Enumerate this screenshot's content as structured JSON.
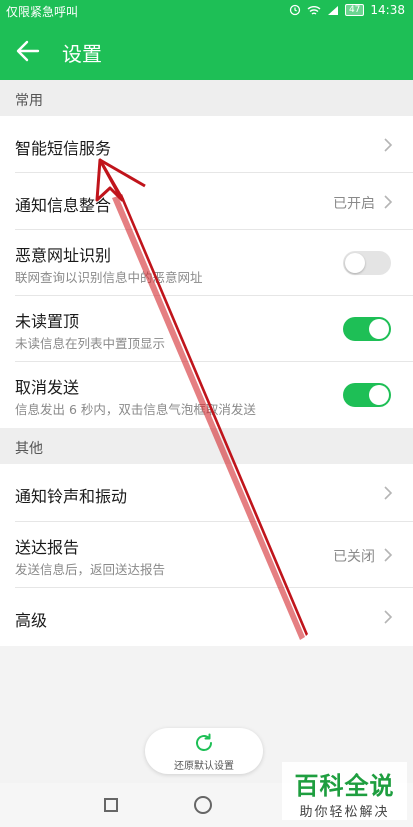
{
  "status_bar": {
    "carrier": "仅限紧急呼叫",
    "battery": "47",
    "time": "14:38"
  },
  "app_bar": {
    "title": "设置"
  },
  "sections": {
    "common": "常用",
    "other": "其他"
  },
  "items": {
    "smart_sms": {
      "title": "智能短信服务"
    },
    "notify_merge": {
      "title": "通知信息整合",
      "value": "已开启"
    },
    "malicious_url": {
      "title": "恶意网址识别",
      "subtitle": "联网查询以识别信息中的恶意网址",
      "enabled": false
    },
    "unread_top": {
      "title": "未读置顶",
      "subtitle": "未读信息在列表中置顶显示",
      "enabled": true
    },
    "cancel_send": {
      "title": "取消发送",
      "subtitle": "信息发出 6 秒内，双击信息气泡框取消发送",
      "enabled": true
    },
    "ringtone": {
      "title": "通知铃声和振动"
    },
    "delivery_report": {
      "title": "送达报告",
      "subtitle": "发送信息后，返回送达报告",
      "value": "已关闭"
    },
    "advanced": {
      "title": "高级"
    }
  },
  "restore_button": {
    "label": "还原默认设置"
  },
  "watermark": {
    "title": "百科全说",
    "subtitle": "助你轻松解决"
  },
  "colors": {
    "accent": "#1ebf56",
    "annotation_arrow": "#c0141b"
  },
  "icons": {
    "back": "arrow-left-icon",
    "chevron": "chevron-right-icon",
    "restore": "refresh-icon",
    "nav_recent": "square-icon",
    "nav_home": "circle-icon"
  }
}
